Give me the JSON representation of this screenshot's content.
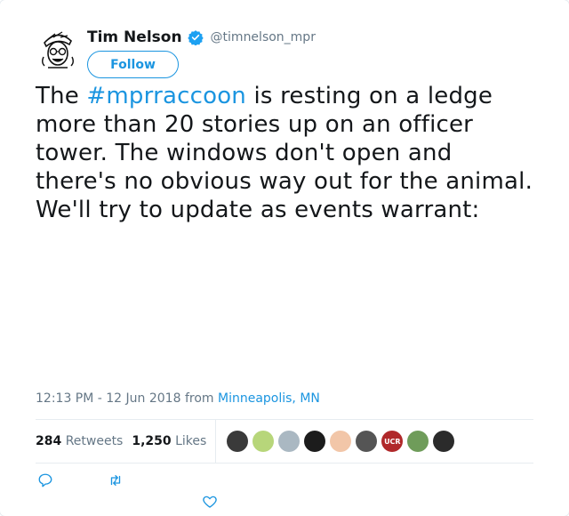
{
  "user": {
    "name": "Tim Nelson",
    "handle": "@timnelson_mpr",
    "follow_label": "Follow",
    "verified": true,
    "avatar_icon": "illustrated-portrait-avatar"
  },
  "tweet": {
    "text_before": "The ",
    "hashtag": "#mprraccoon",
    "text_after": " is resting on a ledge more than 20 stories up on an officer tower. The windows don't open and there's no obvious way out for the animal. We'll try to update as events warrant:"
  },
  "meta": {
    "time_date": "12:13 PM - 12 Jun 2018",
    "from_label": "from",
    "place": "Minneapolis, MN"
  },
  "stats": {
    "retweets_count": "284",
    "retweets_label": "Retweets",
    "likes_count": "1,250",
    "likes_label": "Likes"
  },
  "likers": [
    {
      "name": "liker-avatar-1",
      "color": "#3a3a3a"
    },
    {
      "name": "liker-avatar-2",
      "color": "#b7d67a"
    },
    {
      "name": "liker-avatar-3",
      "color": "#aab8c2"
    },
    {
      "name": "liker-avatar-4",
      "color": "#1c1c1c"
    },
    {
      "name": "liker-avatar-5",
      "color": "#f2c6a8"
    },
    {
      "name": "liker-avatar-6",
      "color": "#555555"
    },
    {
      "name": "liker-avatar-7",
      "color": "#b0282a",
      "text": "UCR"
    },
    {
      "name": "liker-avatar-8",
      "color": "#6f9c5a"
    },
    {
      "name": "liker-avatar-9",
      "color": "#2b2b2b"
    }
  ],
  "actions": {
    "reply_icon": "reply-icon",
    "retweet_icon": "retweet-icon",
    "like_icon": "heart-icon"
  },
  "colors": {
    "accent": "#1b95e0",
    "muted": "#657786",
    "text": "#14171a",
    "divider": "#e6ecf0"
  }
}
